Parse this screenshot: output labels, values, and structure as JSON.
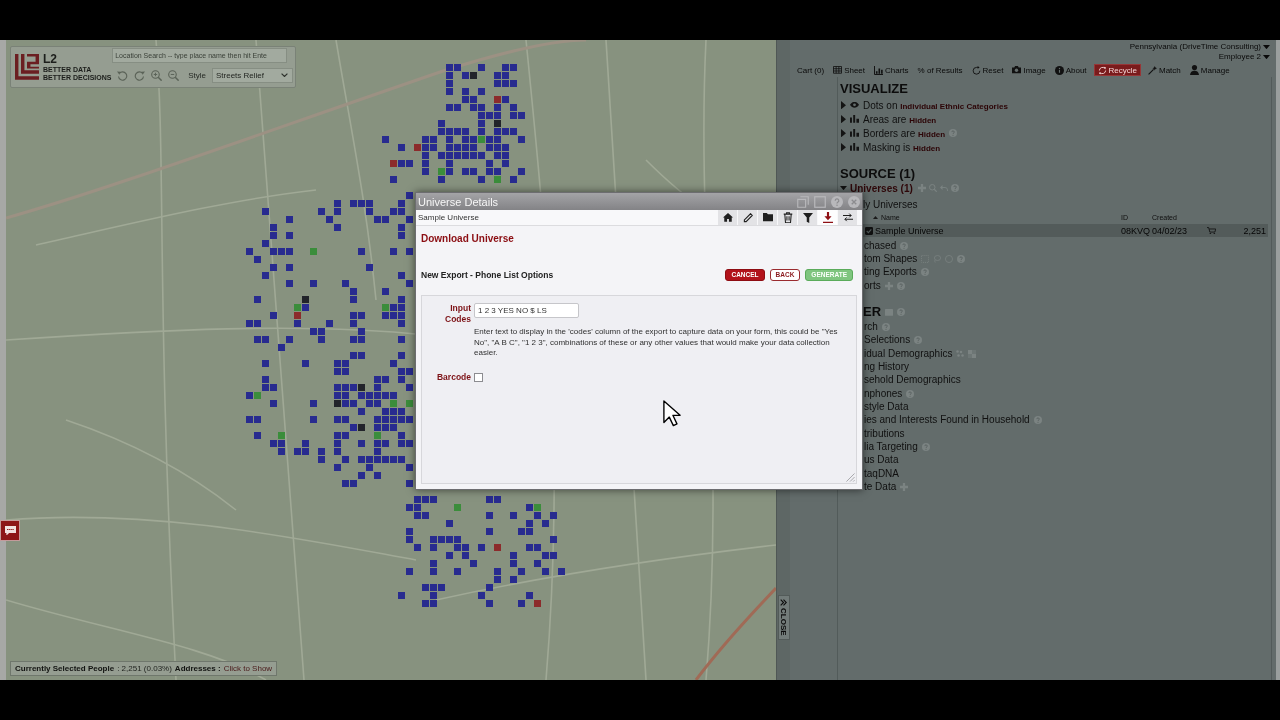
{
  "map": {
    "controls": {
      "logo_title": "L2",
      "logo_tagline": [
        "BETTER DATA",
        "BETTER DECISIONS"
      ],
      "search": {
        "placeholder": "Location Search -- type place name then hit Ente"
      },
      "tools": [
        {
          "kind": "rotate-left"
        },
        {
          "kind": "rotate-right"
        },
        {
          "kind": "zoom-in"
        },
        {
          "kind": "zoom-out"
        }
      ],
      "style_label": "Style",
      "style_value": "Streets Relief"
    },
    "status_bar": {
      "people_label": "Currently Selected People",
      "people_count": ": 2,251 (0.03%)",
      "addresses_label": "Addresses :",
      "addresses_link": "Click to Show"
    }
  },
  "close_tab": {
    "label": "CLOSE"
  },
  "panel": {
    "account": [
      "Pennsylvania (DriveTime Consulting)",
      "Employee 2"
    ],
    "toolbar": [
      {
        "label": "Cart (0)",
        "kind": "text",
        "selected": false
      },
      {
        "label": "Sheet",
        "kind": "grid",
        "selected": false
      },
      {
        "label": "Charts",
        "kind": "chart",
        "selected": false
      },
      {
        "label": "% of Results",
        "kind": "text",
        "selected": false
      },
      {
        "label": "Reset",
        "kind": "reset",
        "selected": false
      },
      {
        "label": "Image",
        "kind": "camera",
        "selected": false
      },
      {
        "label": "About",
        "kind": "info",
        "selected": false
      },
      {
        "label": "Recycle",
        "kind": "recycle",
        "selected": true
      },
      {
        "label": "Match",
        "kind": "wand",
        "selected": false
      },
      {
        "label": "Manage",
        "kind": "person",
        "selected": false
      }
    ],
    "visualize": {
      "title": "VISUALIZE",
      "items": [
        {
          "text": "Dots on **Individual Ethnic Categories**",
          "kind": "eye",
          "expanded": false
        },
        {
          "text": "Areas are **Hidden**",
          "kind": "bars",
          "expanded": false
        },
        {
          "text": "Borders are **Hidden**",
          "kind": "bars",
          "expanded": false,
          "actions": [
            {
              "kind": "help"
            }
          ]
        },
        {
          "text": "Masking is **Hidden**",
          "kind": "bars",
          "expanded": false
        }
      ]
    },
    "source": {
      "title": "SOURCE (1)",
      "universes": {
        "label": "Universes (1)",
        "expanded": true,
        "actions": [
          {
            "kind": "add"
          },
          {
            "kind": "search"
          },
          {
            "kind": "undo"
          },
          {
            "kind": "help"
          }
        ]
      },
      "my_universes": "ly Universes",
      "table": {
        "columns": [
          {
            "label": "Name",
            "sorted": true
          },
          {
            "label": "ID",
            "sorted": false
          },
          {
            "label": "Created",
            "sorted": false
          }
        ],
        "rows": [
          {
            "name": "Sample Universe",
            "id": "08KVQ",
            "created": "04/02/23",
            "count": "2,251",
            "checked": true,
            "selected": true
          }
        ]
      },
      "items": [
        {
          "label": "chased",
          "actions": [
            {
              "kind": "help"
            }
          ]
        },
        {
          "label": "tom Shapes",
          "actions": [
            {
              "kind": "rectangle"
            },
            {
              "kind": "lasso"
            },
            {
              "kind": "circle"
            },
            {
              "kind": "help"
            }
          ]
        },
        {
          "label": "ting Exports",
          "actions": [
            {
              "kind": "help"
            }
          ]
        },
        {
          "label": "orts",
          "actions": [
            {
              "kind": "add"
            },
            {
              "kind": "help"
            }
          ]
        }
      ]
    },
    "filter": {
      "title": "ER",
      "actions": [
        {
          "kind": "square"
        },
        {
          "kind": "help"
        }
      ],
      "items": [
        {
          "label": "rch",
          "actions": [
            {
              "kind": "help"
            }
          ]
        },
        {
          "label": "Selections",
          "actions": [
            {
              "kind": "help"
            }
          ]
        },
        {
          "label": "idual Demographics",
          "actions": [
            {
              "kind": "dots"
            },
            {
              "kind": "checker"
            }
          ]
        },
        {
          "label": "ng History"
        },
        {
          "label": "sehold Demographics"
        },
        {
          "label": "nphones",
          "actions": [
            {
              "kind": "help"
            }
          ]
        },
        {
          "label": "style Data"
        },
        {
          "label": "ies and Interests Found in Household",
          "actions": [
            {
              "kind": "help"
            }
          ]
        },
        {
          "label": "tributions"
        },
        {
          "label": "lia Targeting",
          "actions": [
            {
              "kind": "help"
            }
          ]
        },
        {
          "label": "us Data"
        },
        {
          "label": "taqDNA"
        },
        {
          "label": "te Data",
          "actions": [
            {
              "kind": "add"
            }
          ]
        }
      ]
    }
  },
  "dialog": {
    "title": "Universe Details",
    "window_controls": [
      {
        "kind": "restore"
      },
      {
        "kind": "maximize"
      },
      {
        "kind": "help"
      },
      {
        "kind": "close"
      }
    ],
    "subtitle": "Sample Universe",
    "tabs": [
      {
        "kind": "home",
        "selected": false
      },
      {
        "kind": "edit",
        "selected": false
      },
      {
        "kind": "folder",
        "selected": false
      },
      {
        "kind": "trash",
        "selected": false
      },
      {
        "kind": "filter",
        "selected": false
      },
      {
        "kind": "download",
        "selected": true
      },
      {
        "kind": "swap",
        "selected": false
      }
    ],
    "heading": "Download Universe",
    "section": "New Export - Phone List Options",
    "buttons": [
      {
        "label": "CANCEL",
        "kind": "danger"
      },
      {
        "label": "BACK",
        "kind": "outline"
      },
      {
        "label": "GENERATE",
        "kind": "success"
      }
    ],
    "form": {
      "input_label": "Input Codes",
      "input_value": "1 2 3 YES NO $ LS",
      "hint": "Enter text to display in the 'codes' column of the export to capture data on your form, this could be \"Yes No\", \"A B C\", \"1 2 3\", combinations of these or any other values that would make your data collection easier.",
      "barcode_label": "Barcode",
      "barcode_checked": false
    }
  }
}
